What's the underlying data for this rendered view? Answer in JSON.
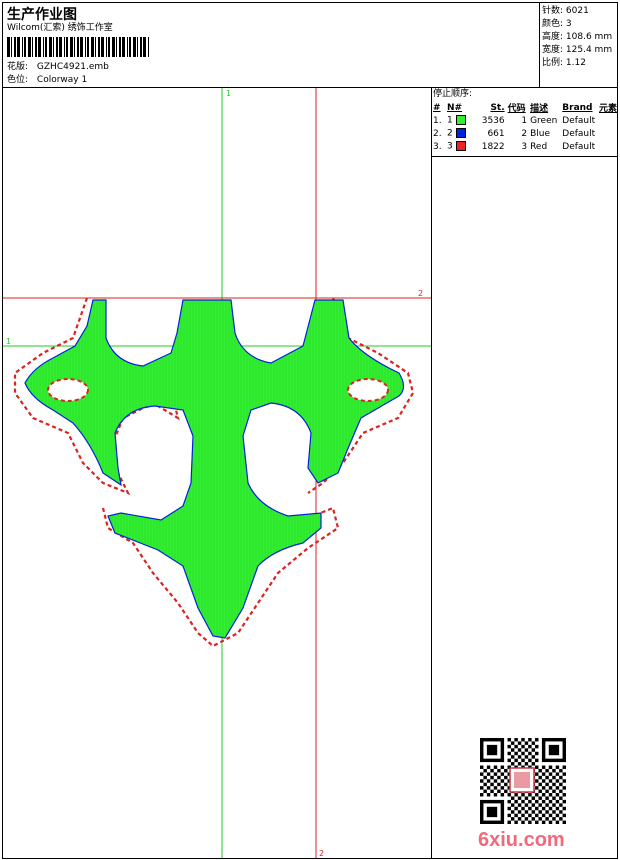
{
  "header": {
    "title": "生产作业图",
    "company": "Wilcom(汇索) 绣饰工作室",
    "design_label": "花版:",
    "design_value": "GZHC4921.emb",
    "colorway_label": "色位:",
    "colorway_value": "Colorway 1"
  },
  "stats": [
    {
      "label": "针数:",
      "value": "6021"
    },
    {
      "label": "颜色:",
      "value": "3"
    },
    {
      "label": "高度:",
      "value": "108.6 mm"
    },
    {
      "label": "宽度:",
      "value": "125.4 mm"
    },
    {
      "label": "比例:",
      "value": "1.12"
    }
  ],
  "stop_sequence": {
    "title": "停止顺序:",
    "columns": [
      "#",
      "N#",
      "St.",
      "代码",
      "描述",
      "Brand",
      "元素"
    ],
    "rows": [
      {
        "idx": "1.",
        "n": "1",
        "color": "#33ee33",
        "stitches": "3536",
        "code": "1",
        "desc": "Green",
        "brand": "Default"
      },
      {
        "idx": "2.",
        "n": "2",
        "color": "#0022dd",
        "stitches": "661",
        "code": "2",
        "desc": "Blue",
        "brand": "Default"
      },
      {
        "idx": "3.",
        "n": "3",
        "color": "#ee2222",
        "stitches": "1822",
        "code": "3",
        "desc": "Red",
        "brand": "Default"
      }
    ]
  },
  "guides": {
    "green_label_top": "1",
    "green_label_left": "1",
    "red_label_right": "2",
    "red_label_bottom": "2"
  },
  "watermark": "6xiu.com",
  "colors": {
    "fill": "#33ee33",
    "outline": "#0022dd",
    "satin": "#ee2222",
    "guide_green": "#22cc22",
    "guide_red": "#dd2222"
  }
}
